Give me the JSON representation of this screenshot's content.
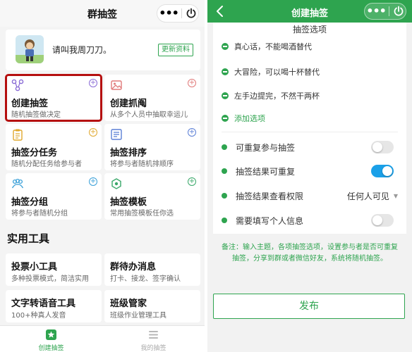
{
  "left": {
    "header": {
      "title": "群抽签"
    },
    "profile": {
      "name": "请叫我周刀刀。",
      "update_label": "更新资料"
    },
    "cards": [
      {
        "title": "创建抽签",
        "subtitle": "随机抽签做决定",
        "icon": "link-nodes-icon"
      },
      {
        "title": "创建抓阄",
        "subtitle": "从多个人员中抽取幸运儿",
        "icon": "image-icon"
      },
      {
        "title": "抽签分任务",
        "subtitle": "随机分配任务给参与者",
        "icon": "clipboard-icon"
      },
      {
        "title": "抽签排序",
        "subtitle": "将参与者随机排顺序",
        "icon": "sort-list-icon"
      },
      {
        "title": "抽签分组",
        "subtitle": "将参与者随机分组",
        "icon": "group-icon"
      },
      {
        "title": "抽签模板",
        "subtitle": "常用抽签模板任你选",
        "icon": "template-icon"
      }
    ],
    "section_title": "实用工具",
    "tools": [
      {
        "title": "投票小工具",
        "subtitle": "多种投票模式，简洁实用"
      },
      {
        "title": "群待办消息",
        "subtitle": "打卡、接龙、签字确认"
      },
      {
        "title": "文字转语音工具",
        "subtitle": "100+种真人发音"
      },
      {
        "title": "班级管家",
        "subtitle": "班级作业管理工具"
      }
    ],
    "tabbar": [
      {
        "label": "创建抽签",
        "active": true
      },
      {
        "label": "我的抽签",
        "active": false
      }
    ]
  },
  "right": {
    "header": {
      "title": "创建抽签"
    },
    "options_header": "抽签选项",
    "options": [
      "真心话，不能喝酒替代",
      "大冒险，可以喝十杯替代",
      "左手边提完，不然干两杯"
    ],
    "add_option_label": "添加选项",
    "settings": [
      {
        "label": "可重复参与抽签",
        "toggle": false
      },
      {
        "label": "抽签结果可重复",
        "toggle": true
      }
    ],
    "permission": {
      "label": "抽签结果查看权限",
      "value": "任何人可见"
    },
    "personal_info": {
      "label": "需要填写个人信息",
      "toggle": false
    },
    "note": "备注：输入主题，各项抽签选项，设置参与者是否可重复抽签，分享到群或者微信好友，系统将随机抽签。",
    "publish_label": "发布"
  },
  "colors": {
    "brand_green": "#2ea44f",
    "toggle_on": "#1aa0e8",
    "highlight_red": "#b50f0f"
  }
}
